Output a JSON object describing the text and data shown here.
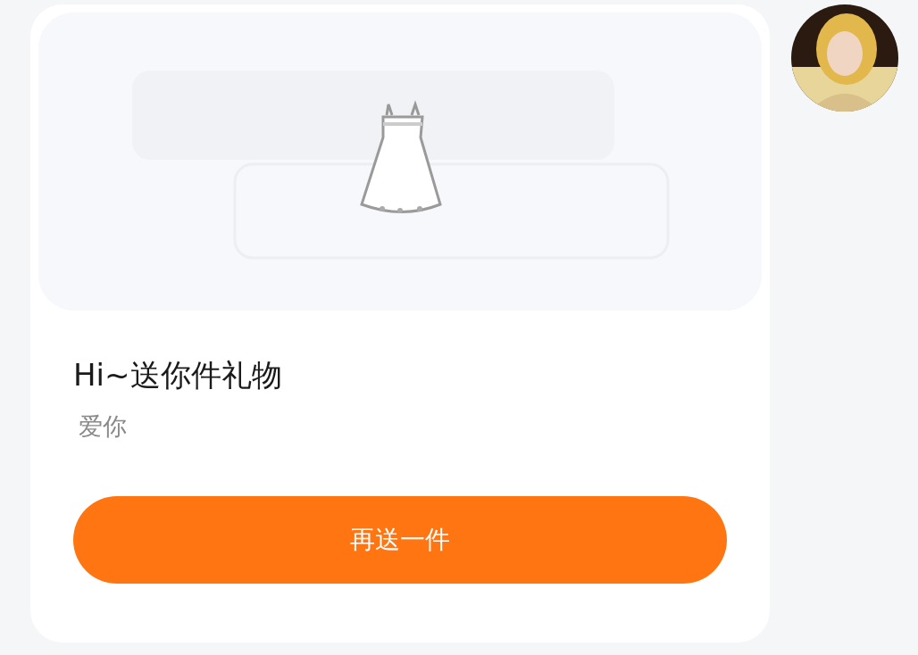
{
  "gift_card": {
    "title": "Hi~送你件礼物",
    "message": "爱你",
    "button": "再送一件"
  }
}
